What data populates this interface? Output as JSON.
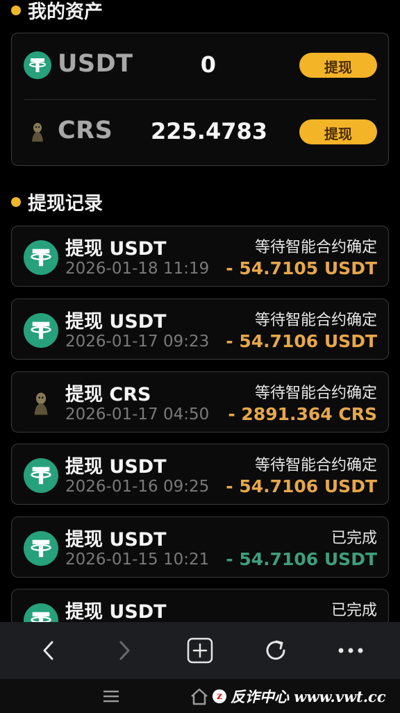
{
  "assets": {
    "title": "我的资产",
    "items": [
      {
        "symbol": "USDT",
        "amount": "0",
        "action": "提现",
        "icon": "usdt-icon"
      },
      {
        "symbol": "CRS",
        "amount": "225.4783",
        "action": "提现",
        "icon": "crs-icon"
      }
    ]
  },
  "records": {
    "title": "提现记录",
    "items": [
      {
        "title": "提现 USDT",
        "time": "2026-01-18 11:19",
        "status": "等待智能合约确定",
        "amount": "- 54.7105 USDT",
        "icon": "usdt-icon",
        "state": "pending"
      },
      {
        "title": "提现 USDT",
        "time": "2026-01-17 09:23",
        "status": "等待智能合约确定",
        "amount": "- 54.7106 USDT",
        "icon": "usdt-icon",
        "state": "pending"
      },
      {
        "title": "提现 CRS",
        "time": "2026-01-17 04:50",
        "status": "等待智能合约确定",
        "amount": "- 2891.364 CRS",
        "icon": "crs-icon",
        "state": "pending"
      },
      {
        "title": "提现 USDT",
        "time": "2026-01-16 09:25",
        "status": "等待智能合约确定",
        "amount": "- 54.7106 USDT",
        "icon": "usdt-icon",
        "state": "pending"
      },
      {
        "title": "提现 USDT",
        "time": "2026-01-15 10:21",
        "status": "已完成",
        "amount": "- 54.7106 USDT",
        "icon": "usdt-icon",
        "state": "done"
      },
      {
        "title": "提现 USDT",
        "time": "",
        "status": "已完成",
        "amount": "",
        "icon": "usdt-icon",
        "state": "done"
      }
    ]
  },
  "colors": {
    "accent": "#f0b729",
    "pending_amount": "#e7a74a",
    "done_amount": "#3f9e7c",
    "usdt": "#26a17b"
  },
  "watermark": {
    "badge": "z",
    "text": "反诈中心 www.vwt.cc"
  }
}
